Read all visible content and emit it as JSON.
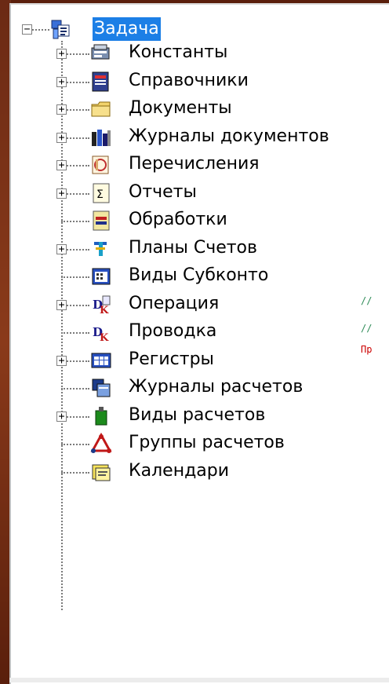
{
  "tree": {
    "root": {
      "label": "Задача",
      "expander": "−",
      "icon": "metadata-tree-icon"
    },
    "items": [
      {
        "label": "Константы",
        "expander": "+",
        "icon": "constants-icon"
      },
      {
        "label": "Справочники",
        "expander": "+",
        "icon": "catalogs-icon"
      },
      {
        "label": "Документы",
        "expander": "+",
        "icon": "documents-folder-icon"
      },
      {
        "label": "Журналы документов",
        "expander": "+",
        "icon": "document-journals-icon"
      },
      {
        "label": "Перечисления",
        "expander": "+",
        "icon": "enumerations-icon"
      },
      {
        "label": "Отчеты",
        "expander": "+",
        "icon": "reports-sigma-icon"
      },
      {
        "label": "Обработки",
        "expander": "",
        "icon": "processing-icon"
      },
      {
        "label": "Планы Счетов",
        "expander": "+",
        "icon": "chart-of-accounts-icon"
      },
      {
        "label": "Виды Субконто",
        "expander": "",
        "icon": "subconto-types-icon"
      },
      {
        "label": "Операция",
        "expander": "+",
        "icon": "operation-icon"
      },
      {
        "label": "Проводка",
        "expander": "",
        "icon": "entry-dk-icon"
      },
      {
        "label": "Регистры",
        "expander": "+",
        "icon": "registers-icon"
      },
      {
        "label": "Журналы расчетов",
        "expander": "",
        "icon": "calculation-journals-icon"
      },
      {
        "label": "Виды расчетов",
        "expander": "+",
        "icon": "calculation-types-icon"
      },
      {
        "label": "Группы расчетов",
        "expander": "",
        "icon": "calculation-groups-icon"
      },
      {
        "label": "Календари",
        "expander": "",
        "icon": "calendars-icon"
      }
    ]
  },
  "background_code": {
    "line1": "//",
    "line2": "//",
    "line3": "Пр"
  },
  "colors": {
    "selection": "#1c7fe6",
    "code_comment": "#2e8b57",
    "code_keyword": "#cc0000"
  }
}
